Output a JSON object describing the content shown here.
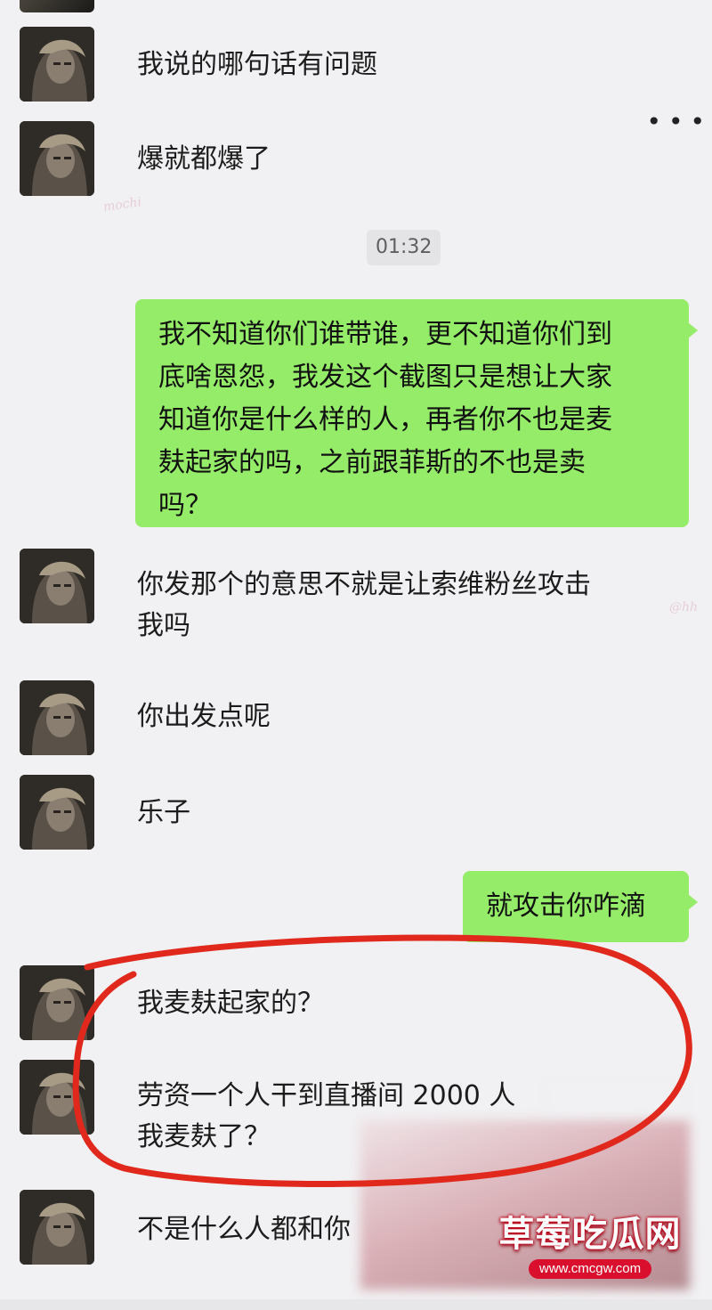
{
  "timestamp": "01:32",
  "messages": [
    {
      "id": "m1",
      "from": "other",
      "text": "我说的哪句话有问题"
    },
    {
      "id": "m2",
      "from": "other",
      "text": "爆就都爆了"
    },
    {
      "id": "m3",
      "from": "me",
      "lines": [
        "我不知道你们谁带谁，更不知道你们到",
        "底啥恩怨，我发这个截图只是想让大家",
        "知道你是什么样的人，再者你不也是麦",
        "麸起家的吗，之前跟菲斯的不也是卖",
        "吗？"
      ]
    },
    {
      "id": "m4",
      "from": "other",
      "lines": [
        "你发那个的意思不就是让索维粉丝攻击",
        "我吗"
      ]
    },
    {
      "id": "m5",
      "from": "other",
      "text": "你出发点呢"
    },
    {
      "id": "m6",
      "from": "other",
      "text": "乐子"
    },
    {
      "id": "m7",
      "from": "me",
      "text": "就攻击你咋滴"
    },
    {
      "id": "m8",
      "from": "other",
      "text": "我麦麸起家的？"
    },
    {
      "id": "m9",
      "from": "other",
      "lines": [
        "劳资一个人干到直播间 2000 人",
        "我麦麸了？"
      ]
    },
    {
      "id": "m10",
      "from": "other",
      "text": "不是什么人都和你"
    }
  ],
  "decorations": {
    "corner_mark": "mochi",
    "side_mark": "@hh"
  },
  "watermark": {
    "title": "草莓吃瓜网",
    "url": "www.cmcgw.com"
  },
  "colors": {
    "outgoing_bubble": "#95ec69",
    "background": "#f1f0f2",
    "annotation_circle": "#e0291c",
    "watermark_red": "#d90f2d"
  },
  "icons": {
    "avatar": "user-avatar-icon",
    "more": "more-dots-icon"
  }
}
